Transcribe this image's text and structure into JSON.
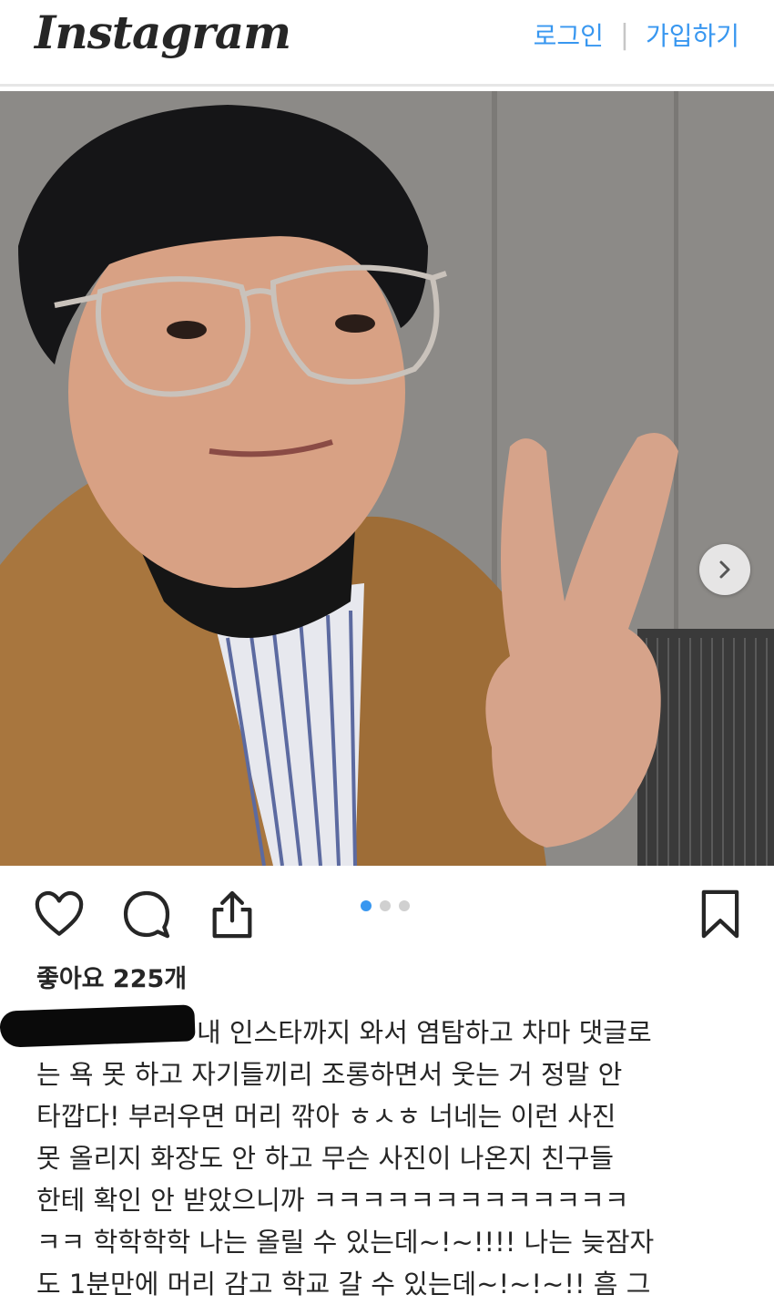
{
  "header": {
    "logo": "Instagram",
    "login": "로그인",
    "separator": "|",
    "signup": "가입하기"
  },
  "post": {
    "image": "selfie-photo",
    "carousel": {
      "current": 1,
      "total": 3
    },
    "likes_text": "좋아요 225개",
    "caption_lines": [
      "내 인스타까지 와서 염탐하고 차마 댓글로",
      "는 욕 못 하고 자기들끼리 조롱하면서 웃는 거 정말 안",
      "타깝다! 부러우면 머리 깎아 ㅎㅅㅎ 너네는 이런 사진",
      "못 올리지 화장도 안 하고 무슨 사진이 나온지 친구들",
      "한테 확인 안 받았으니까 ㅋㅋㅋㅋㅋㅋㅋㅋㅋㅋㅋㅋㅋ",
      "ㅋㅋ 학학학학 나는 올릴 수 있는데~!~!!!! 나는 늦잠자",
      "도 1분만에 머리 감고 학교 갈 수 있는데~!~!~!! 흠 그"
    ]
  },
  "icons": {
    "heart": "heart-icon",
    "comment": "comment-icon",
    "share": "share-icon",
    "bookmark": "bookmark-icon",
    "next": "chevron-right-icon"
  },
  "colors": {
    "accent": "#3897f0",
    "text": "#262626",
    "divider": "#e6e6e6"
  }
}
